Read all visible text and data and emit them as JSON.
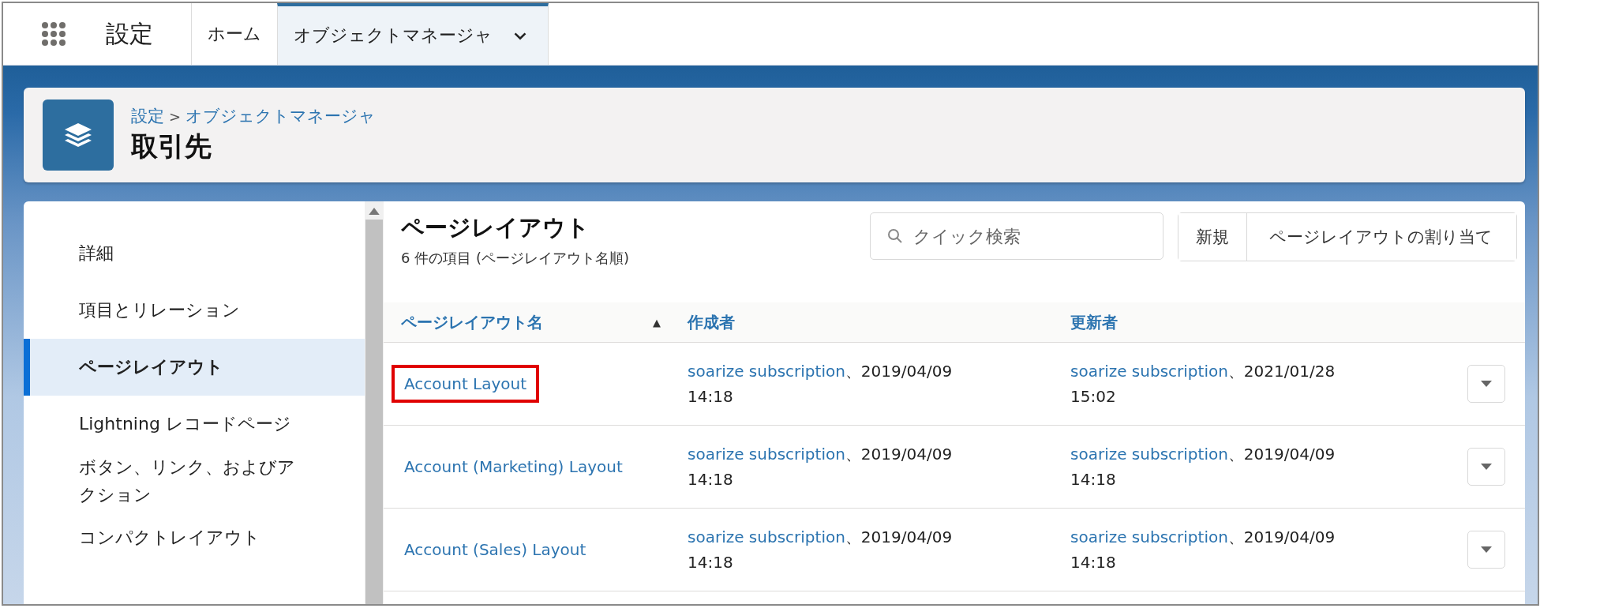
{
  "top_bar": {
    "app_name": "設定",
    "tabs": [
      {
        "label": "ホーム",
        "selected": false,
        "has_menu": false
      },
      {
        "label": "オブジェクトマネージャ",
        "selected": true,
        "has_menu": true
      }
    ]
  },
  "header": {
    "breadcrumb": [
      {
        "label": "設定"
      },
      {
        "label": "オブジェクトマネージャ"
      }
    ],
    "separator": ">",
    "title": "取引先"
  },
  "sidebar": {
    "items": [
      {
        "label": "詳細",
        "selected": false
      },
      {
        "label": "項目とリレーション",
        "selected": false
      },
      {
        "label": "ページレイアウト",
        "selected": true
      },
      {
        "label": "Lightning レコードページ",
        "selected": false
      },
      {
        "label": "ボタン、リンク、およびアクション",
        "selected": false
      },
      {
        "label": "コンパクトレイアウト",
        "selected": false
      }
    ]
  },
  "content": {
    "title": "ページレイアウト",
    "subtitle": "6 件の項目 (ページレイアウト名順)",
    "search": {
      "placeholder": "クイック検索"
    },
    "buttons": [
      "新規",
      "ページレイアウトの割り当て"
    ]
  },
  "table": {
    "columns": [
      {
        "label": "ページレイアウト名",
        "sort": "▲"
      },
      {
        "label": "作成者"
      },
      {
        "label": "更新者"
      }
    ],
    "rows": [
      {
        "name": "Account Layout",
        "highlighted": true,
        "created": {
          "user": "soarize subscription",
          "date": "、2019/04/09",
          "time": "14:18"
        },
        "modified": {
          "user": "soarize subscription",
          "date": "、2021/01/28",
          "time": "15:02"
        }
      },
      {
        "name": "Account (Marketing) Layout",
        "highlighted": false,
        "created": {
          "user": "soarize subscription",
          "date": "、2019/04/09",
          "time": "14:18"
        },
        "modified": {
          "user": "soarize subscription",
          "date": "、2019/04/09",
          "time": "14:18"
        }
      },
      {
        "name": "Account (Sales) Layout",
        "highlighted": false,
        "created": {
          "user": "soarize subscription",
          "date": "、2019/04/09",
          "time": "14:18"
        },
        "modified": {
          "user": "soarize subscription",
          "date": "、2019/04/09",
          "time": "14:18"
        }
      }
    ]
  }
}
